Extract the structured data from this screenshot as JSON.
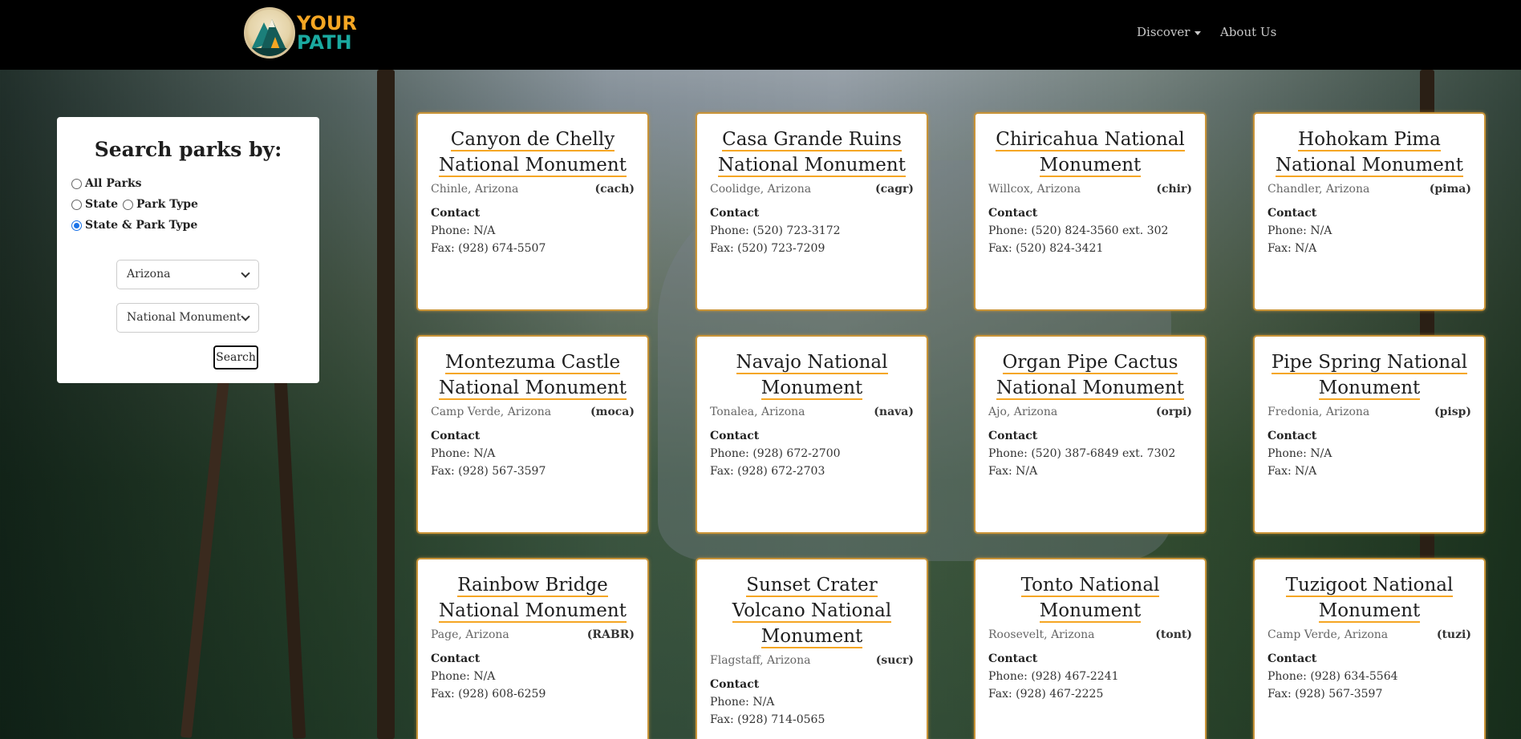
{
  "nav": {
    "logo_word1": "YOUR",
    "logo_word2": "PATH",
    "discover": "Discover",
    "about": "About Us"
  },
  "search": {
    "title": "Search parks by:",
    "options": {
      "all": "All Parks",
      "state": "State",
      "park_type": "Park Type",
      "state_park_type": "State & Park Type"
    },
    "selected_option": "State & Park Type",
    "state_value": "Arizona",
    "type_value": "National Monument",
    "button": "Search"
  },
  "contact_label": "Contact",
  "parks": [
    {
      "title": "Canyon de Chelly National Monument",
      "location": "Chinle, Arizona",
      "code": "(cach)",
      "phone": "Phone: N/A",
      "fax": "Fax: (928) 674-5507"
    },
    {
      "title": "Casa Grande Ruins National Monument",
      "location": "Coolidge, Arizona",
      "code": "(cagr)",
      "phone": "Phone: (520) 723-3172",
      "fax": "Fax: (520) 723-7209"
    },
    {
      "title": "Chiricahua National Monument",
      "location": "Willcox, Arizona",
      "code": "(chir)",
      "phone": "Phone: (520) 824-3560 ext. 302",
      "fax": "Fax: (520) 824-3421"
    },
    {
      "title": "Hohokam Pima National Monument",
      "location": "Chandler, Arizona",
      "code": "(pima)",
      "phone": "Phone: N/A",
      "fax": "Fax: N/A"
    },
    {
      "title": "Montezuma Castle National Monument",
      "location": "Camp Verde, Arizona",
      "code": "(moca)",
      "phone": "Phone: N/A",
      "fax": "Fax: (928) 567-3597"
    },
    {
      "title": "Navajo National Monument",
      "location": "Tonalea, Arizona",
      "code": "(nava)",
      "phone": "Phone: (928) 672-2700",
      "fax": "Fax: (928) 672-2703"
    },
    {
      "title": "Organ Pipe Cactus National Monument",
      "location": "Ajo, Arizona",
      "code": "(orpi)",
      "phone": "Phone: (520) 387-6849 ext. 7302",
      "fax": "Fax: N/A"
    },
    {
      "title": "Pipe Spring National Monument",
      "location": "Fredonia, Arizona",
      "code": "(pisp)",
      "phone": "Phone: N/A",
      "fax": "Fax: N/A"
    },
    {
      "title": "Rainbow Bridge National Monument",
      "location": "Page, Arizona",
      "code": "(RABR)",
      "phone": "Phone: N/A",
      "fax": "Fax: (928) 608-6259"
    },
    {
      "title": "Sunset Crater Volcano National Monument",
      "location": "Flagstaff, Arizona",
      "code": "(sucr)",
      "phone": "Phone: N/A",
      "fax": "Fax: (928) 714-0565"
    },
    {
      "title": "Tonto National Monument",
      "location": "Roosevelt, Arizona",
      "code": "(tont)",
      "phone": "Phone: (928) 467-2241",
      "fax": "Fax: (928) 467-2225"
    },
    {
      "title": "Tuzigoot National Monument",
      "location": "Camp Verde, Arizona",
      "code": "(tuzi)",
      "phone": "Phone: (928) 634-5564",
      "fax": "Fax: (928) 567-3597"
    }
  ],
  "colors": {
    "accent": "#f5a623",
    "card_border": "#c99438",
    "nav_bg": "#000000"
  }
}
